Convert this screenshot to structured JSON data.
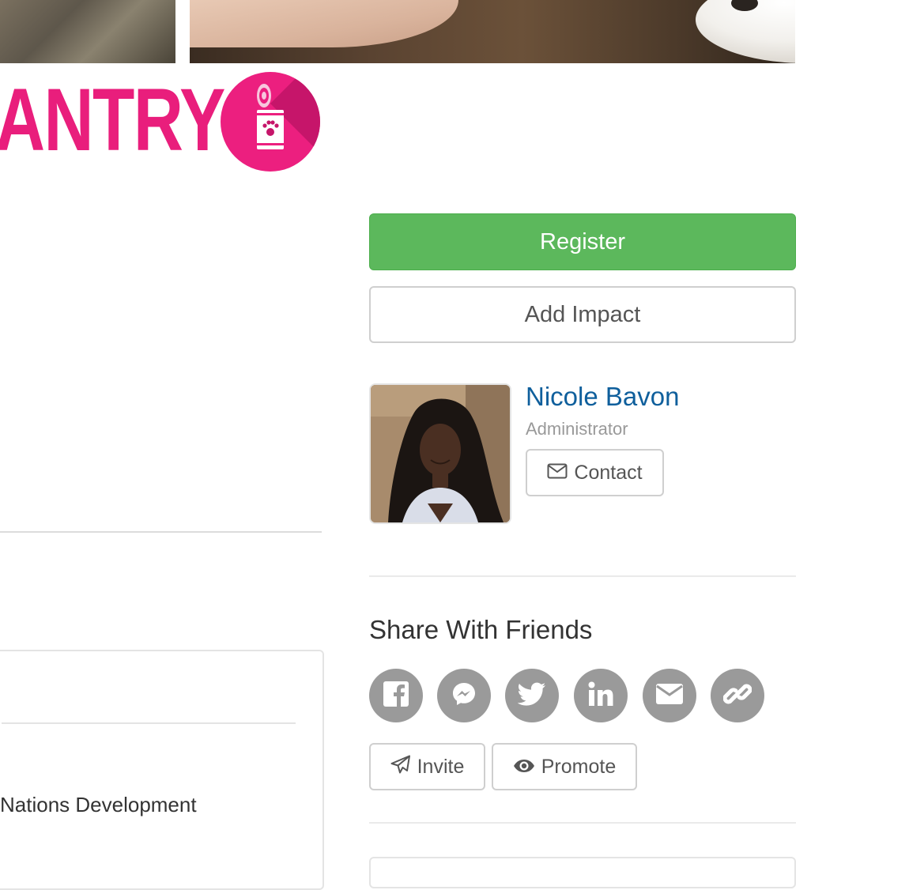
{
  "hero": {
    "left_photo_icon": "person-photo",
    "right_photo_icon": "dog-photo"
  },
  "logo": {
    "text": "ANTRY",
    "icon": "pet-food-can-icon",
    "color": "#e91e7c"
  },
  "actions": {
    "register_label": "Register",
    "add_impact_label": "Add Impact",
    "register_color": "#5cb85c"
  },
  "admin": {
    "name": "Nicole Bavon",
    "role": "Administrator",
    "contact_label": "Contact",
    "contact_icon": "envelope-icon",
    "name_color": "#0f5f9c"
  },
  "share": {
    "title": "Share With Friends",
    "buttons": [
      {
        "name": "facebook",
        "icon": "facebook-icon"
      },
      {
        "name": "messenger",
        "icon": "messenger-icon"
      },
      {
        "name": "twitter",
        "icon": "twitter-icon"
      },
      {
        "name": "linkedin",
        "icon": "linkedin-icon"
      },
      {
        "name": "email",
        "icon": "envelope-icon"
      },
      {
        "name": "copy-link",
        "icon": "link-icon"
      }
    ],
    "invite_label": "Invite",
    "invite_icon": "paper-plane-icon",
    "promote_label": "Promote",
    "promote_icon": "eye-icon"
  },
  "details": {
    "organization_text": "Nations Development"
  }
}
